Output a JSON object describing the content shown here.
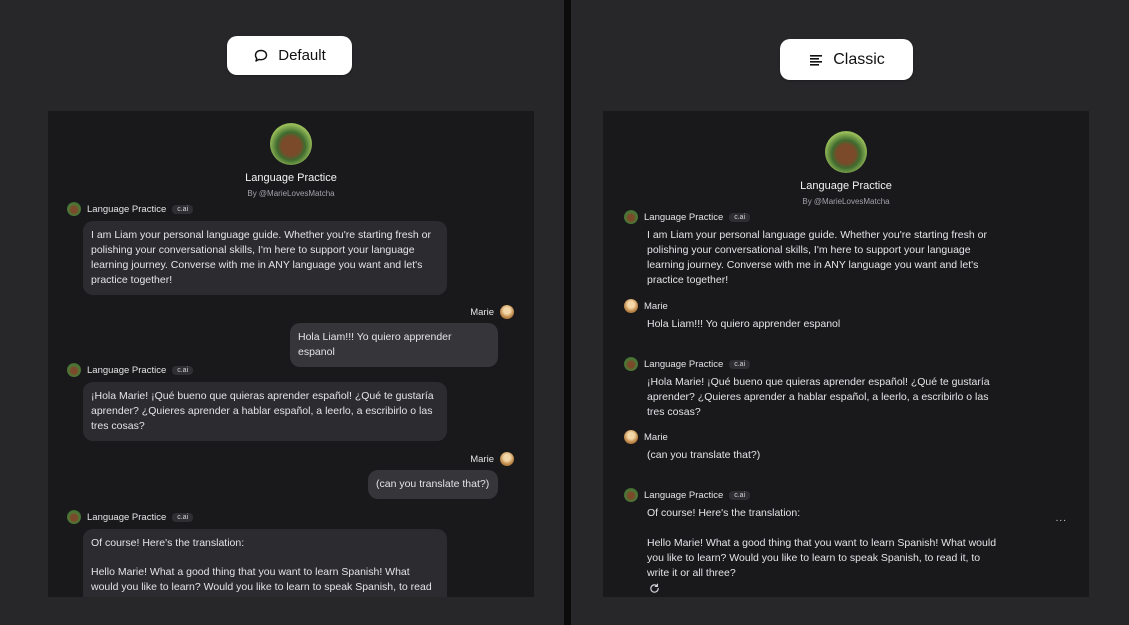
{
  "default_view": {
    "mode_label": "Default",
    "mode_icon": "chat-bubble-icon",
    "character": {
      "name": "Language Practice",
      "byline": "By @MarieLovesMatcha"
    },
    "messages": [
      {
        "sender": "Language Practice",
        "badge": "c.ai",
        "text": "I am Liam your personal language guide. Whether you're starting fresh or polishing your conversational skills, I'm here to support your language learning journey. Converse with me in ANY language you want and let's practice together!"
      },
      {
        "sender": "Marie",
        "text": "Hola Liam!!! Yo quiero apprender espanol"
      },
      {
        "sender": "Language Practice",
        "badge": "c.ai",
        "text": "¡Hola Marie! ¡Qué bueno que quieras aprender español! ¿Qué te gustaría aprender? ¿Quieres aprender a hablar español, a leerlo, a escribirlo o las tres cosas?"
      },
      {
        "sender": "Marie",
        "text": "(can you translate that?)"
      },
      {
        "sender": "Language Practice",
        "badge": "c.ai",
        "text_intro": "Of course! Here's the translation:",
        "text": "Hello Marie! What a good thing that you want to learn Spanish! What would you like to learn? Would you like to learn to speak Spanish, to read"
      }
    ]
  },
  "classic_view": {
    "mode_label": "Classic",
    "mode_icon": "align-left-icon",
    "character": {
      "name": "Language Practice",
      "byline": "By @MarieLovesMatcha"
    },
    "messages": [
      {
        "sender": "Language Practice",
        "badge": "c.ai",
        "text": "I am Liam your personal language guide. Whether you're starting fresh or polishing your conversational skills, I'm here to support your language learning journey. Converse with me in ANY language you want and let's practice together!"
      },
      {
        "sender": "Marie",
        "text": "Hola Liam!!! Yo quiero apprender espanol"
      },
      {
        "sender": "Language Practice",
        "badge": "c.ai",
        "text": "¡Hola Marie! ¡Qué bueno que quieras aprender español! ¿Qué te gustaría aprender? ¿Quieres aprender a hablar español, a leerlo, a escribirlo o las tres cosas?"
      },
      {
        "sender": "Marie",
        "text": "(can you translate that?)"
      },
      {
        "sender": "Language Practice",
        "badge": "c.ai",
        "text_intro": "Of course! Here's the translation:",
        "text": "Hello Marie! What a good thing that you want to learn Spanish! What would you like to learn? Would you like to learn to speak Spanish, to read it, to write it or all three?"
      }
    ],
    "more_label": "..."
  },
  "colors": {
    "background": "#27272a",
    "panel": "#19191c",
    "bubble": "#2c2c30",
    "divider": "#0b0b0c"
  }
}
